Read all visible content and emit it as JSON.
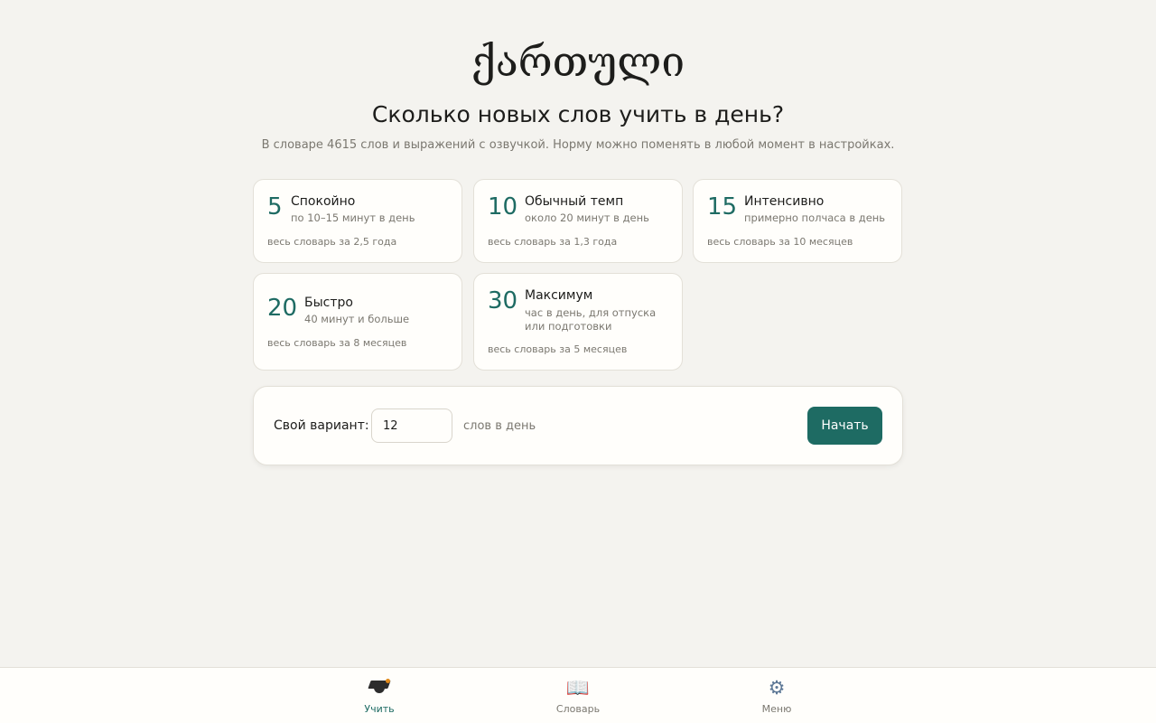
{
  "header": {
    "logo": "ქართული",
    "title": "Сколько новых слов учить в день?",
    "subtitle": "В словаре 4615 слов и выражений с озвучкой. Норму можно поменять в любой момент в настройках."
  },
  "options": [
    {
      "number": "5",
      "name": "Спокойно",
      "description": "по 10–15 минут в день",
      "total": "весь словарь за 2,5 года"
    },
    {
      "number": "10",
      "name": "Обычный темп",
      "description": "около 20 минут в день",
      "total": "весь словарь за 1,3 года"
    },
    {
      "number": "15",
      "name": "Интенсивно",
      "description": "примерно полчаса в день",
      "total": "весь словарь за 10 месяцев"
    },
    {
      "number": "20",
      "name": "Быстро",
      "description": "40 минут и больше",
      "total": "весь словарь за 8 месяцев"
    },
    {
      "number": "30",
      "name": "Максимум",
      "description": "час в день, для отпуска или подготовки",
      "total": "весь словарь за 5 месяцев"
    }
  ],
  "custom": {
    "label": "Свой вариант:",
    "value": "12",
    "unit": "слов в день",
    "start_label": "Начать"
  },
  "nav": {
    "active": "learn",
    "items": [
      {
        "id": "learn",
        "label": "Учить",
        "icon": "graduation-cap-icon"
      },
      {
        "id": "dictionary",
        "label": "Словарь",
        "icon": "book-icon"
      },
      {
        "id": "menu",
        "label": "Меню",
        "icon": "gear-icon"
      }
    ]
  },
  "colors": {
    "accent": "#1e6b63",
    "background": "#f4f3ef",
    "card": "#fffefb",
    "muted_text": "#7b7870"
  }
}
